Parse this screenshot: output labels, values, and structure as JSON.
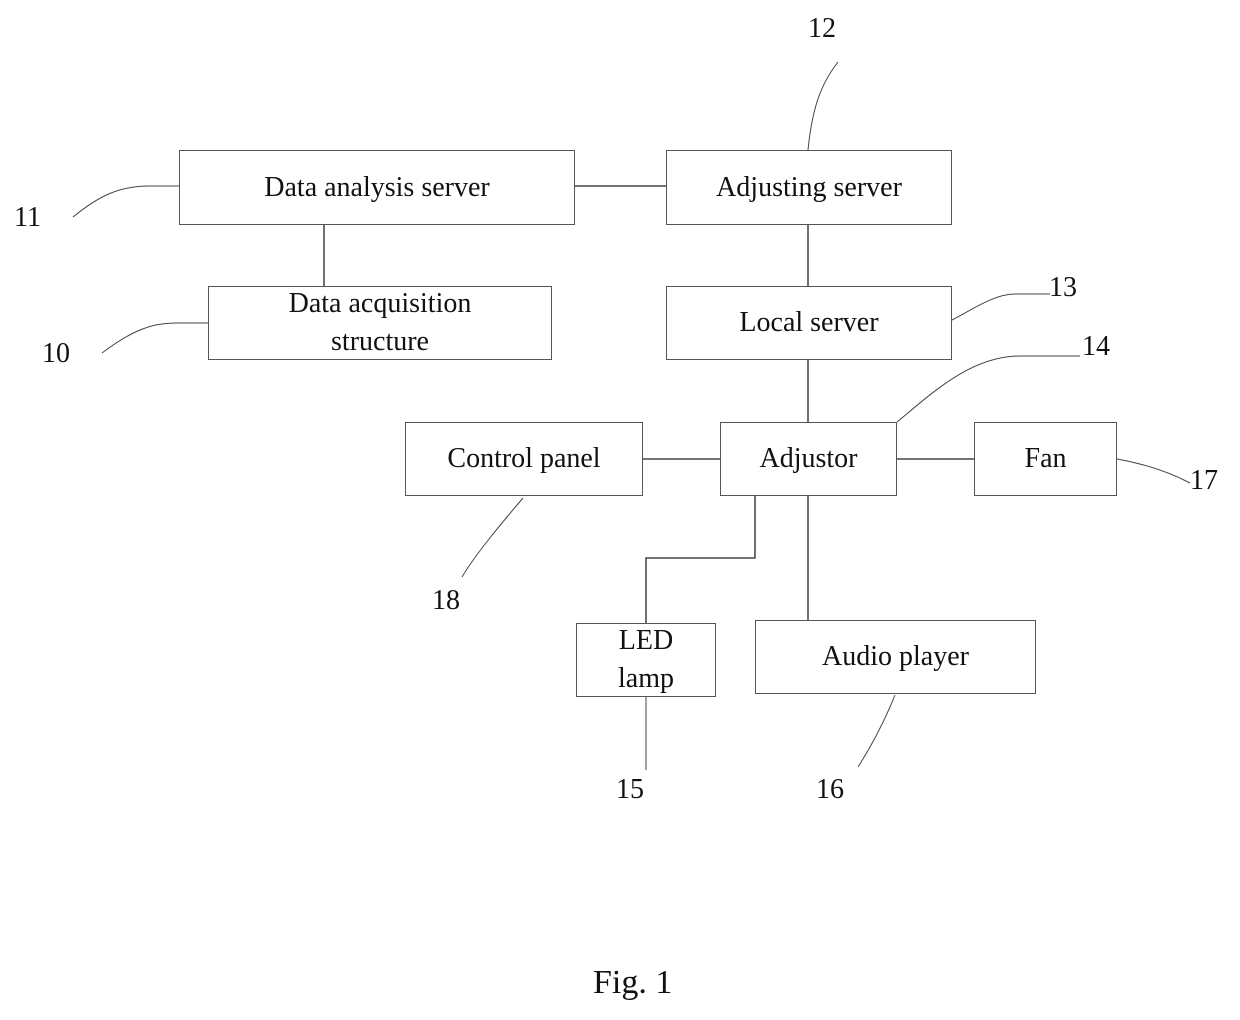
{
  "diagram": {
    "caption": "Fig. 1",
    "blocks": {
      "data_analysis_server": {
        "label": "Data analysis server",
        "ref": "11"
      },
      "adjusting_server": {
        "label": "Adjusting server",
        "ref": "12"
      },
      "data_acquisition_structure": {
        "line1": "Data acquisition",
        "line2": "structure",
        "ref": "10"
      },
      "local_server": {
        "label": "Local server",
        "ref": "13"
      },
      "adjustor": {
        "label": "Adjustor",
        "ref": "14"
      },
      "control_panel": {
        "label": "Control panel",
        "ref": "18"
      },
      "fan": {
        "label": "Fan",
        "ref": "17"
      },
      "led_lamp": {
        "line1": "LED",
        "line2": "lamp",
        "ref": "15"
      },
      "audio_player": {
        "label": "Audio player",
        "ref": "16"
      }
    },
    "connections": [
      [
        "data_analysis_server",
        "adjusting_server"
      ],
      [
        "data_analysis_server",
        "data_acquisition_structure"
      ],
      [
        "adjusting_server",
        "local_server"
      ],
      [
        "local_server",
        "adjustor"
      ],
      [
        "adjustor",
        "control_panel"
      ],
      [
        "adjustor",
        "fan"
      ],
      [
        "adjustor",
        "led_lamp"
      ],
      [
        "adjustor",
        "audio_player"
      ]
    ]
  }
}
